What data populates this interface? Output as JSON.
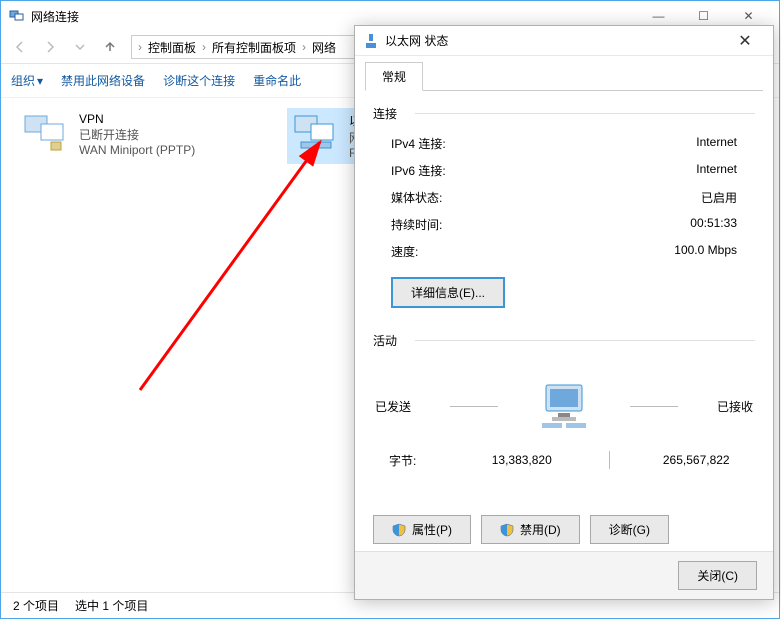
{
  "explorer": {
    "title": "网络连接",
    "breadcrumb": [
      "控制面板",
      "所有控制面板项",
      "网络"
    ],
    "toolbar": {
      "organize": "组织",
      "disable": "禁用此网络设备",
      "diagnose": "诊断这个连接",
      "rename": "重命名此"
    },
    "connections": [
      {
        "name": "VPN",
        "status": "已断开连接",
        "desc": "WAN Miniport (PPTP)",
        "selected": false
      },
      {
        "name": "以太",
        "status": "网络",
        "desc": "Rea",
        "selected": true
      }
    ],
    "statusbar": {
      "count": "2 个项目",
      "selected": "选中 1 个项目"
    }
  },
  "dialog": {
    "title": "以太网 状态",
    "tab": "常规",
    "section_connect": "连接",
    "rows": {
      "ipv4_label": "IPv4 连接:",
      "ipv4_value": "Internet",
      "ipv6_label": "IPv6 连接:",
      "ipv6_value": "Internet",
      "media_label": "媒体状态:",
      "media_value": "已启用",
      "duration_label": "持续时间:",
      "duration_value": "00:51:33",
      "speed_label": "速度:",
      "speed_value": "100.0 Mbps"
    },
    "details_btn": "详细信息(E)...",
    "section_activity": "活动",
    "activity": {
      "sent_label": "已发送",
      "recv_label": "已接收",
      "bytes_label": "字节:",
      "sent_bytes": "13,383,820",
      "recv_bytes": "265,567,822"
    },
    "buttons": {
      "properties": "属性(P)",
      "disable": "禁用(D)",
      "diagnose": "诊断(G)",
      "close": "关闭(C)"
    }
  }
}
